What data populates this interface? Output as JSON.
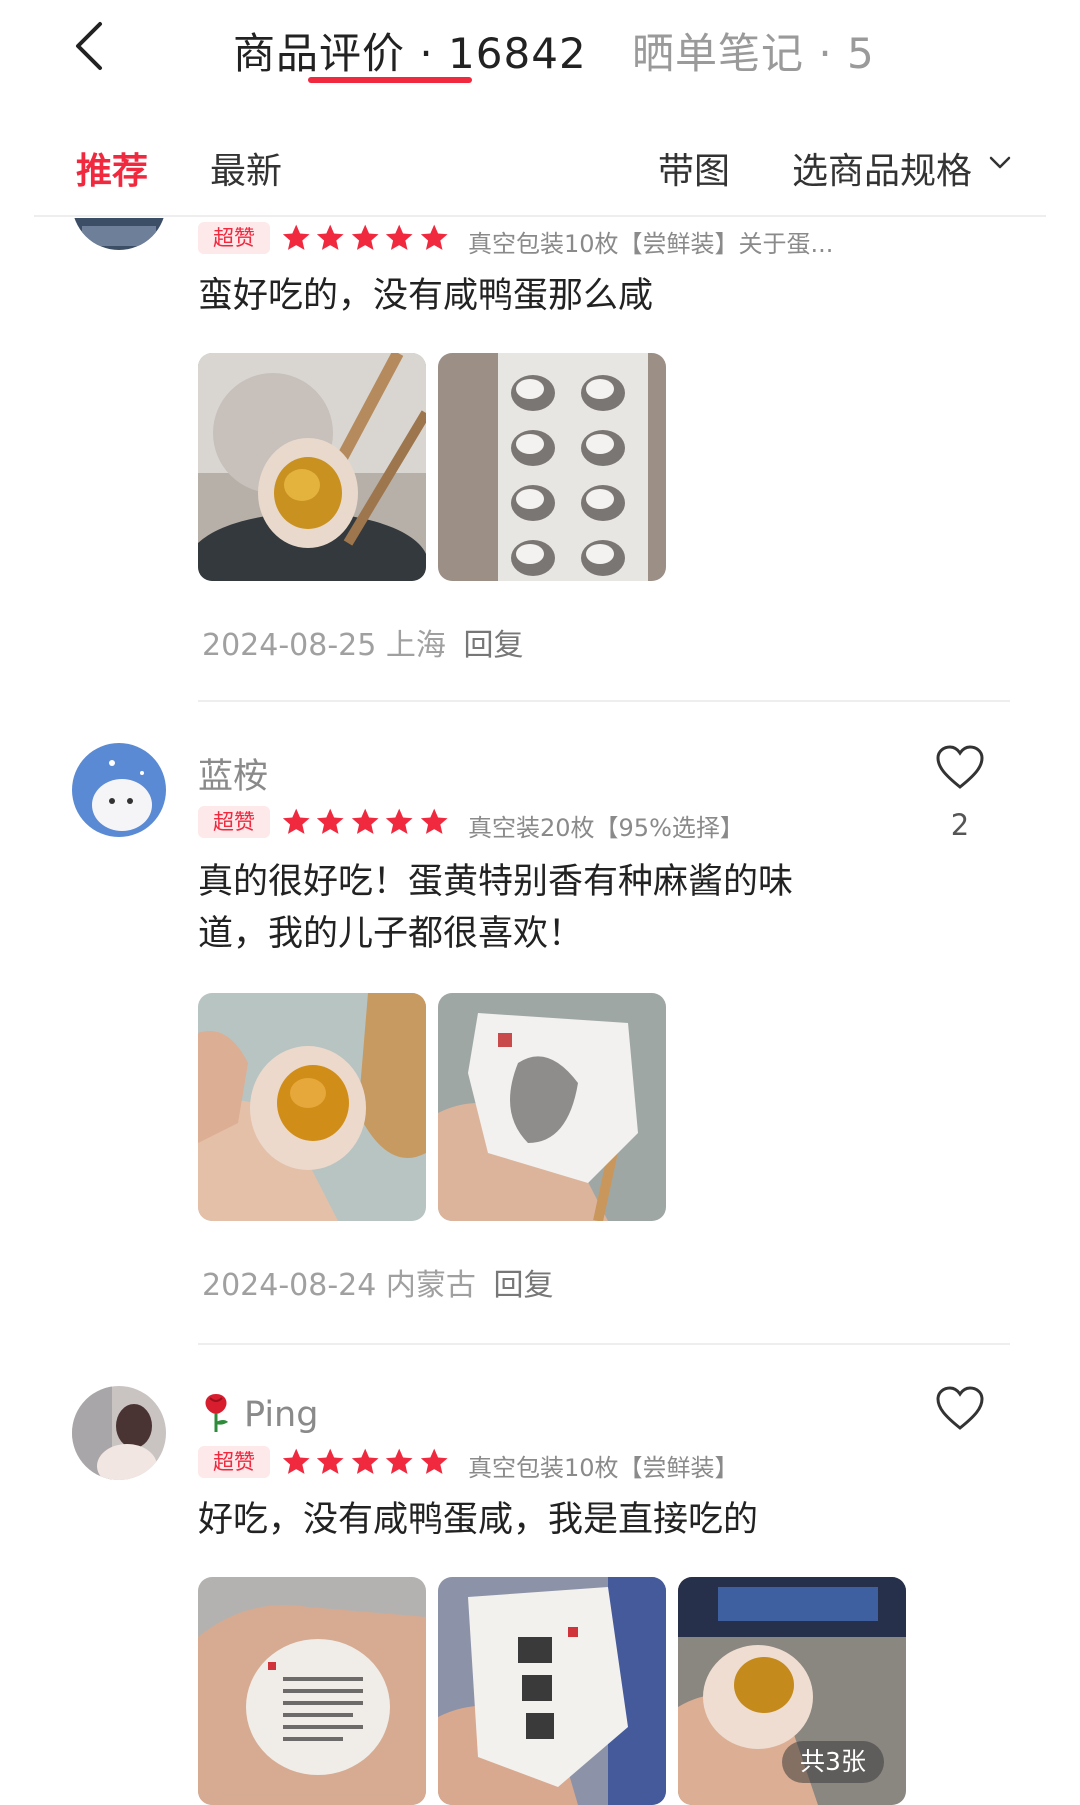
{
  "header": {
    "tabs": [
      {
        "label": "商品评价 · 16842"
      },
      {
        "label": "晒单笔记 · 5"
      }
    ]
  },
  "filters": {
    "recommended": "推荐",
    "latest": "最新",
    "with_images": "带图",
    "select_spec": "选商品规格"
  },
  "colors": {
    "accent": "#f0293f",
    "badge_bg": "#fde8ea",
    "star": "#f0293f"
  },
  "reviews": [
    {
      "badge": "超赞",
      "rating": 5,
      "spec": "真空包装10枚【尝鲜装】关于蛋...",
      "text": "蛮好吃的，没有咸鸭蛋那么咸",
      "photos": [
        "egg-chopsticks-photo",
        "egg-tray-photo"
      ],
      "date": "2024-08-25",
      "location": "上海",
      "reply": "回复"
    },
    {
      "username": "蓝桉",
      "badge": "超赞",
      "rating": 5,
      "spec": "真空装20枚【95%选择】",
      "text": "真的很好吃！蛋黄特别香有种麻酱的味道，我的儿子都很喜欢！",
      "photos": [
        "egg-in-hand-photo",
        "wrapped-egg-photo"
      ],
      "date": "2024-08-24",
      "location": "内蒙古",
      "reply": "回复",
      "likes": "2"
    },
    {
      "username": "Ping",
      "badge": "超赞",
      "rating": 5,
      "spec": "真空包装10枚【尝鲜装】",
      "text": "好吃，没有咸鸭蛋咸，我是直接吃的",
      "photos": [
        "wrapped-egg-label-photo",
        "majiang-egg-package-photo",
        "halved-egg-photo"
      ],
      "photo_count": "共3张"
    }
  ]
}
